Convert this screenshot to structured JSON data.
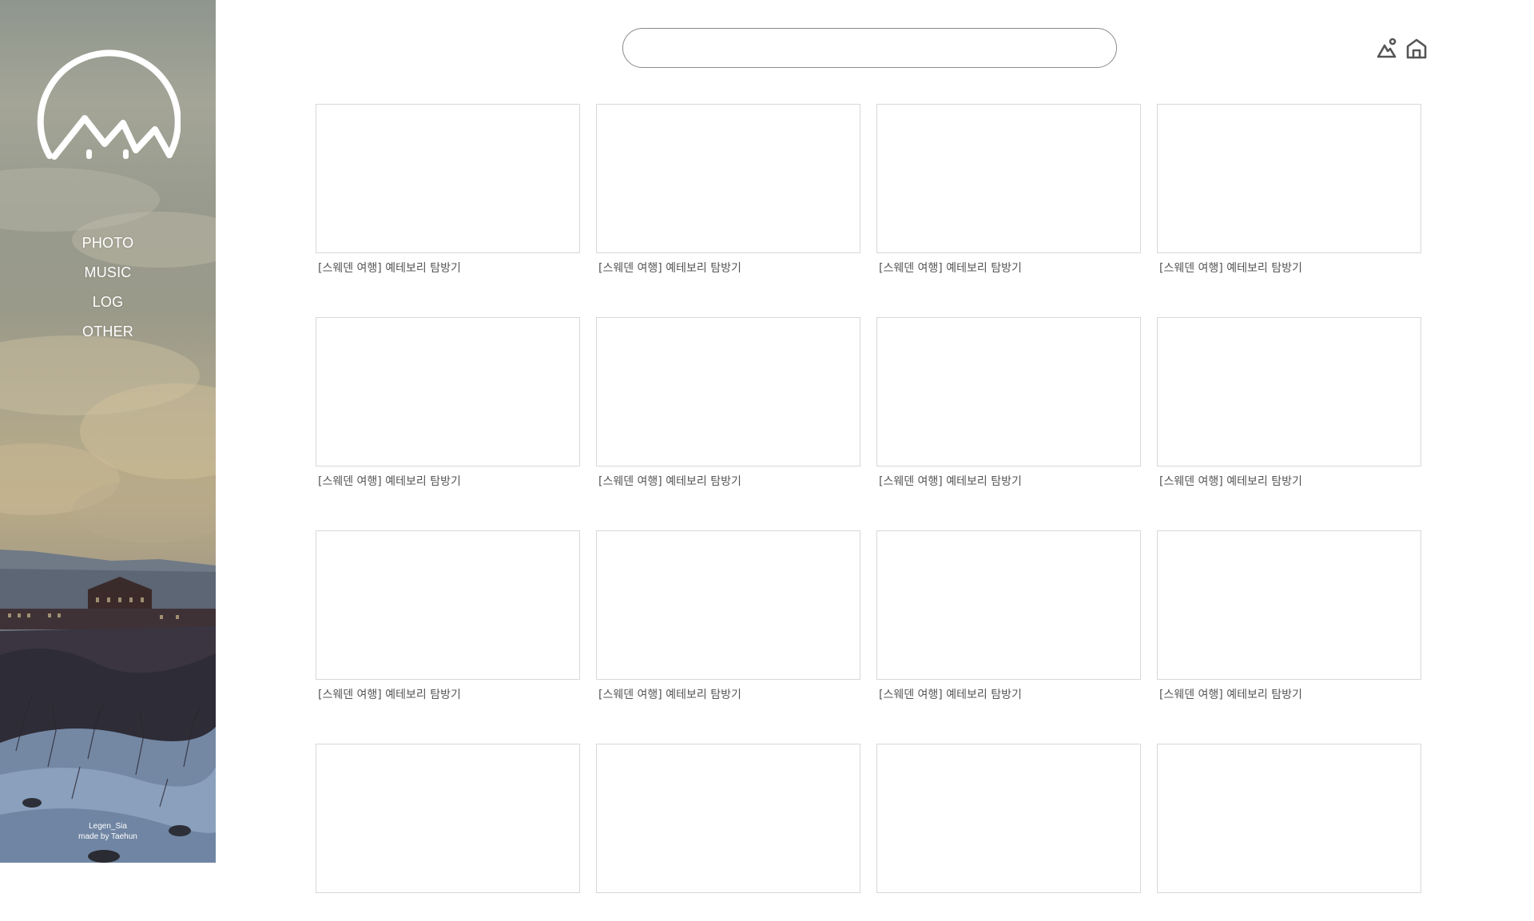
{
  "sidebar": {
    "logo_icon": "mountain-arc-logo",
    "nav": [
      {
        "label": "PHOTO"
      },
      {
        "label": "MUSIC"
      },
      {
        "label": "LOG"
      },
      {
        "label": "OTHER"
      }
    ],
    "credits": {
      "line1": "Legen_Sia",
      "line2": "made by Taehun"
    }
  },
  "header": {
    "search": {
      "value": "",
      "placeholder": ""
    },
    "icons": [
      "mountain-person-icon",
      "home-icon"
    ]
  },
  "grid": {
    "rows_visible": 4,
    "columns": 4,
    "cards": [
      {
        "caption": "[스웨덴 여행] 예테보리 탐방기"
      },
      {
        "caption": "[스웨덴 여행] 예테보리 탐방기"
      },
      {
        "caption": "[스웨덴 여행] 예테보리 탐방기"
      },
      {
        "caption": "[스웨덴 여행] 예테보리 탐방기"
      },
      {
        "caption": "[스웨덴 여행] 예테보리 탐방기"
      },
      {
        "caption": "[스웨덴 여행] 예테보리 탐방기"
      },
      {
        "caption": "[스웨덴 여행] 예테보리 탐방기"
      },
      {
        "caption": "[스웨덴 여행] 예테보리 탐방기"
      },
      {
        "caption": "[스웨덴 여행] 예테보리 탐방기"
      },
      {
        "caption": "[스웨덴 여행] 예테보리 탐방기"
      },
      {
        "caption": "[스웨덴 여행] 예테보리 탐방기"
      },
      {
        "caption": "[스웨덴 여행] 예테보리 탐방기"
      },
      {
        "caption": ""
      },
      {
        "caption": ""
      },
      {
        "caption": ""
      },
      {
        "caption": ""
      }
    ]
  },
  "colors": {
    "sidebar_text": "#ffffff",
    "caption_text": "#555555",
    "card_border": "#d8d8d8",
    "search_border": "#8a8a8a",
    "icon_color": "#555555"
  }
}
